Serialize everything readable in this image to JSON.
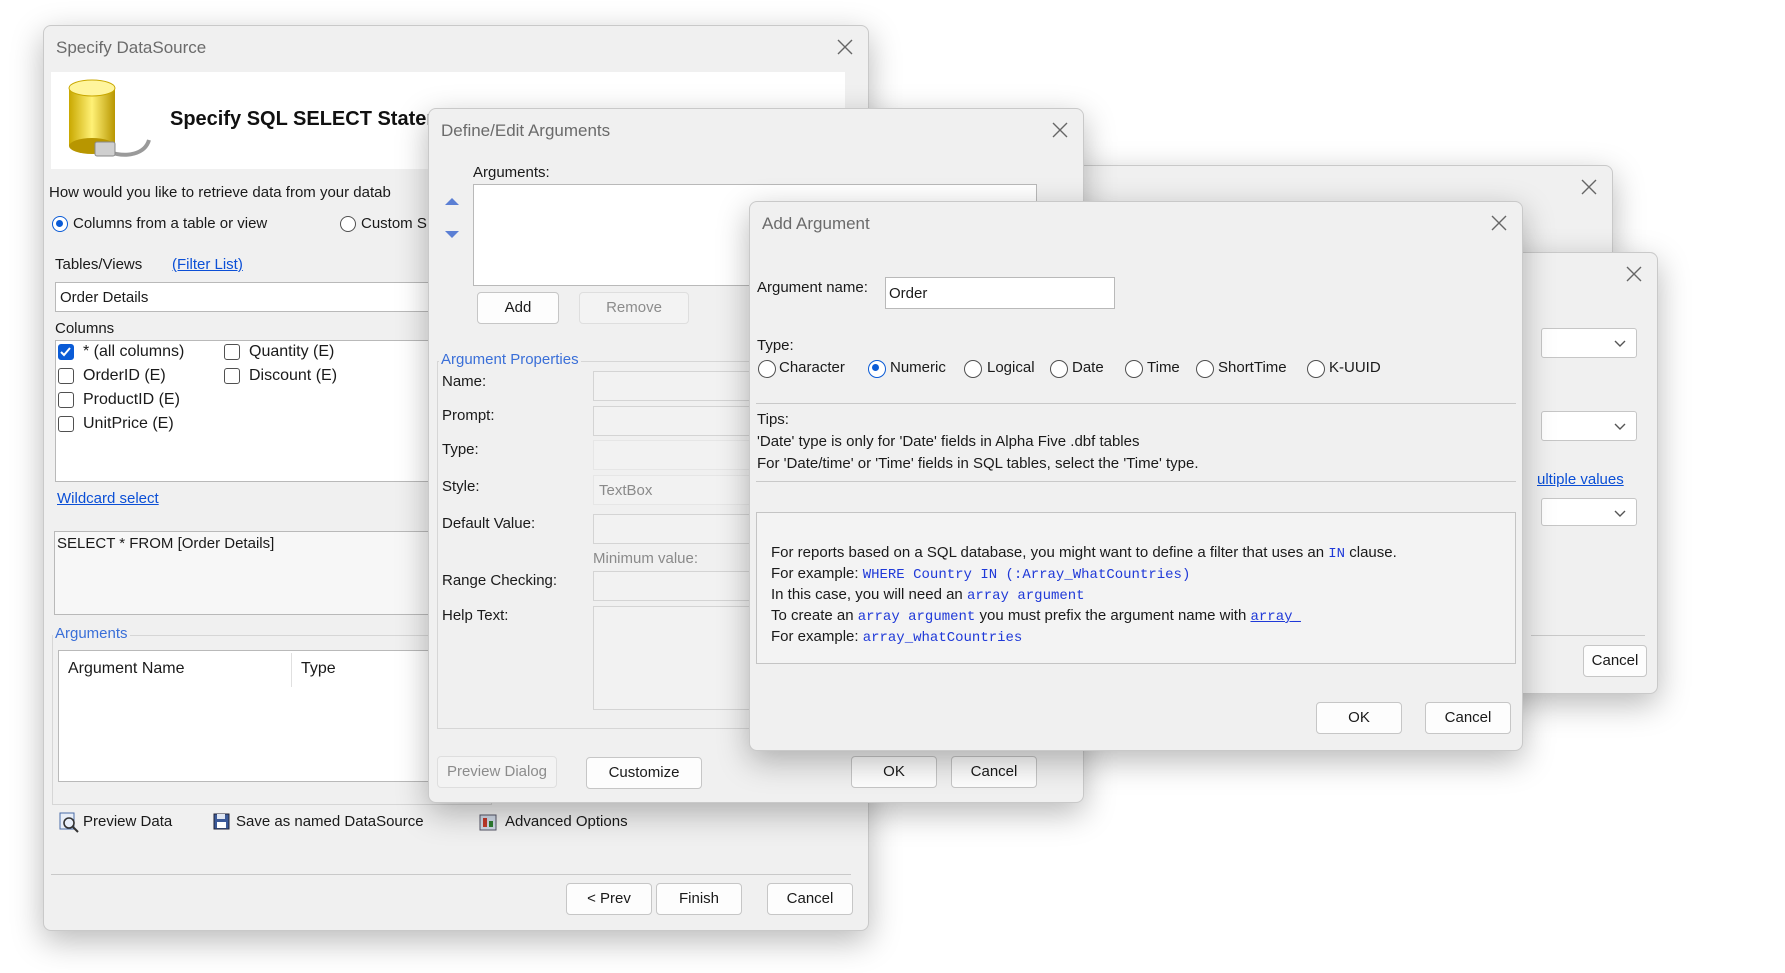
{
  "back_window": {
    "multiple_values_link": "ultiple values",
    "cancel": "Cancel"
  },
  "datasource_dialog": {
    "title": "Specify DataSource",
    "header": "Specify SQL SELECT Statement",
    "question": "How would you like to retrieve data from your datab",
    "radio_columns": "Columns from a table or view",
    "radio_custom": "Custom S",
    "tables_views_label": "Tables/Views",
    "filter_list": "(Filter List)",
    "table_value": "Order Details",
    "columns_label": "Columns",
    "columns": [
      {
        "label": "* (all columns)",
        "checked": true
      },
      {
        "label": "OrderID (E)",
        "checked": false
      },
      {
        "label": "ProductID (E)",
        "checked": false
      },
      {
        "label": "UnitPrice (E)",
        "checked": false
      },
      {
        "label": "Quantity (E)",
        "checked": false
      },
      {
        "label": "Discount (E)",
        "checked": false
      }
    ],
    "wildcard_select": "Wildcard select",
    "sql_text": "SELECT * FROM [Order Details]",
    "arguments_label": "Arguments",
    "arg_col_name": "Argument Name",
    "arg_col_type": "Type",
    "preview_data": "Preview Data",
    "save_named": "Save as named DataSource",
    "advanced_options": "Advanced Options",
    "prev": "< Prev",
    "finish": "Finish",
    "cancel": "Cancel"
  },
  "define_dialog": {
    "title": "Define/Edit Arguments",
    "arguments_label": "Arguments:",
    "add": "Add",
    "remove": "Remove",
    "props_label": "Argument Properties",
    "name_label": "Name:",
    "prompt_label": "Prompt:",
    "type_label": "Type:",
    "style_label": "Style:",
    "style_value": "TextBox",
    "default_label": "Default Value:",
    "minimum_label": "Minimum value:",
    "range_label": "Range Checking:",
    "help_label": "Help Text:",
    "preview_dialog": "Preview Dialog",
    "customize": "Customize",
    "ok": "OK",
    "cancel": "Cancel"
  },
  "add_dialog": {
    "title": "Add Argument",
    "name_label": "Argument name:",
    "name_value": "Order",
    "type_label": "Type:",
    "types": [
      {
        "label": "Character",
        "selected": false
      },
      {
        "label": "Numeric",
        "selected": true
      },
      {
        "label": "Logical",
        "selected": false
      },
      {
        "label": "Date",
        "selected": false
      },
      {
        "label": "Time",
        "selected": false
      },
      {
        "label": "ShortTime",
        "selected": false
      },
      {
        "label": "K-UUID",
        "selected": false
      }
    ],
    "tips_label": "Tips:",
    "tip1": "'Date' type is only for 'Date' fields in Alpha Five .dbf tables",
    "tip2": "For 'Date/time' or 'Time' fields in SQL tables, select the 'Time' type.",
    "info": {
      "l1a": "For reports based on a SQL database, you might want to define a filter that uses an ",
      "l1code": "IN",
      "l1b": " clause.",
      "l2a": "For example: ",
      "l2code": "WHERE Country IN (:Array_WhatCountries)",
      "l3a": "In this case, you will need an ",
      "l3code": "array argument",
      "l4a": "To create an ",
      "l4code": "array argument",
      "l4b": " you must prefix the argument name with ",
      "l4code2": "array_",
      "l5a": "For example: ",
      "l5code": "array_whatCountries"
    },
    "ok": "OK",
    "cancel": "Cancel"
  }
}
